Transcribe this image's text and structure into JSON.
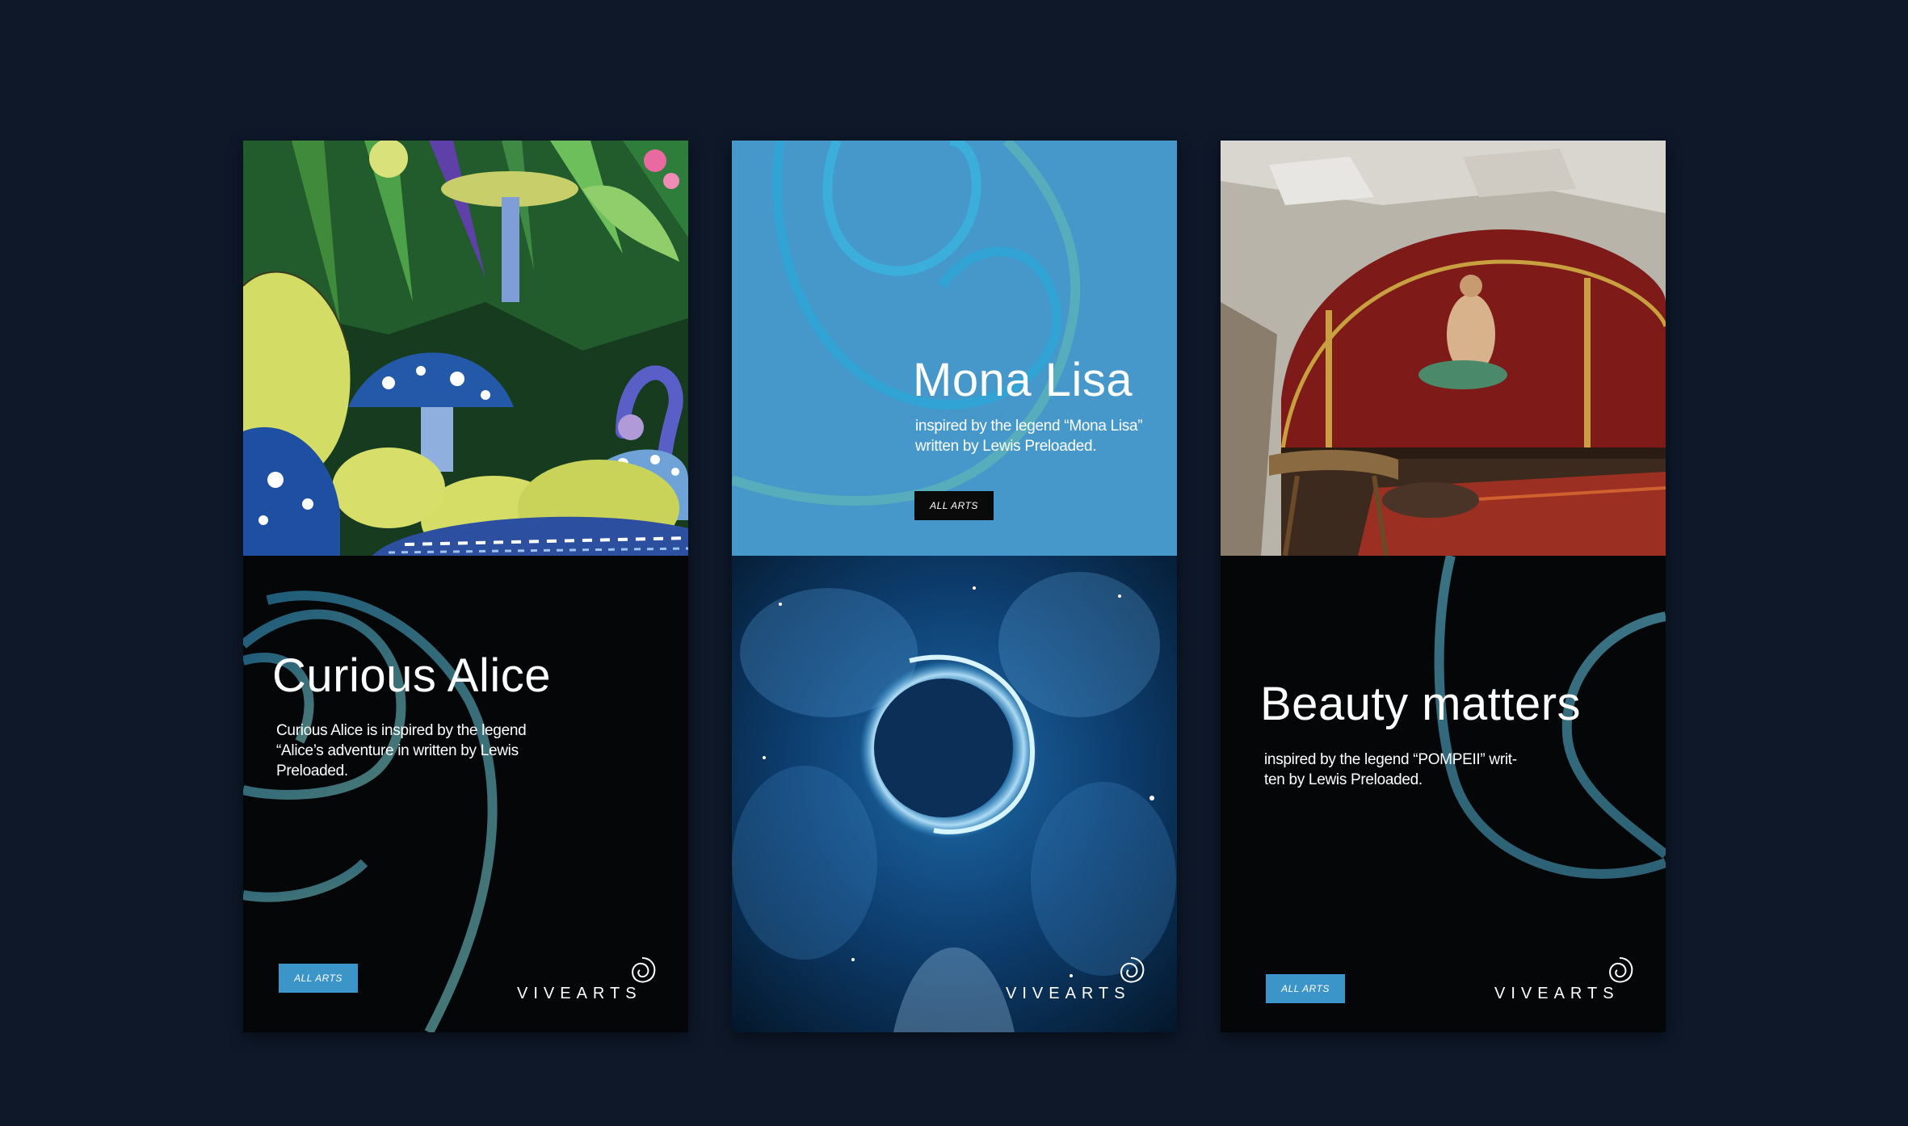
{
  "cards": [
    {
      "title": "Curious Alice",
      "description": "Curious Alice is inspired by the legend “Alice’s adventure in written by Lewis Preloaded.",
      "button_label": "ALL ARTS",
      "brand": "VIVEARTS",
      "image_subject": "wonderland-mushrooms-illustration"
    },
    {
      "title": "Mona Lisa",
      "description": "inspired by the legend “Mona Lisa” written by Lewis Preloaded.",
      "button_label": "ALL ARTS",
      "brand": "VIVEARTS",
      "image_subject": "cosmic-eclipse-nebula"
    },
    {
      "title": "Beauty matters",
      "description": "inspired by the legend “POMPEII” writ- ten by Lewis Preloaded.",
      "button_label": "ALL ARTS",
      "brand": "VIVEARTS",
      "image_subject": "pompeii-fresco-room"
    }
  ],
  "colors": {
    "background": "#0e1829",
    "card_dark": "#050608",
    "accent_blue": "#3b95c9",
    "swirl_teal": "#2d6f86"
  }
}
